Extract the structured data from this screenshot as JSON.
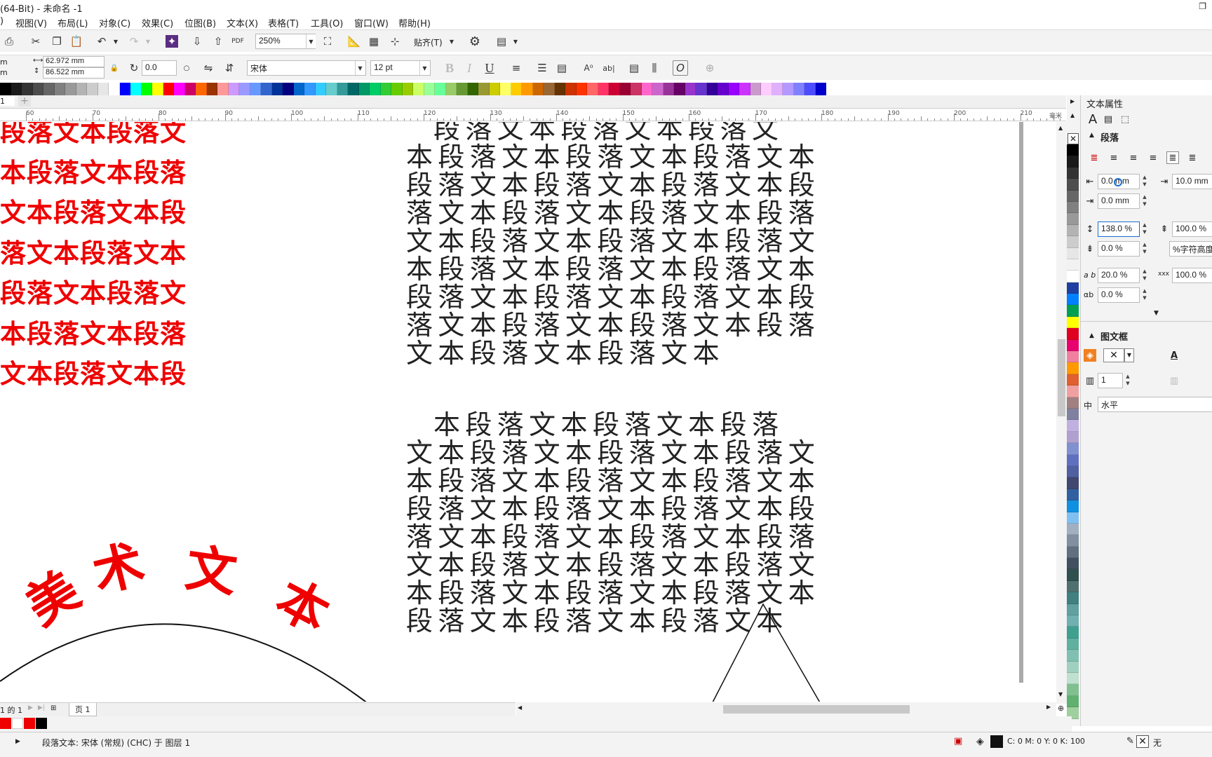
{
  "window": {
    "title": "(64-Bit) - 未命名 -1"
  },
  "menu": [
    "视图(V)",
    "布局(L)",
    "对象(C)",
    "效果(C)",
    "位图(B)",
    "文本(X)",
    "表格(T)",
    "工具(O)",
    "窗口(W)",
    "帮助(H)"
  ],
  "toolbar": {
    "zoom": "250%",
    "snap_label": "贴齐(T)"
  },
  "propbar": {
    "unit_x": "m",
    "unit_y": "m",
    "width": "62.972 mm",
    "height": "86.522 mm",
    "rotation": "0.0",
    "font": "宋体",
    "font_size": "12 pt"
  },
  "doc_tab": "1",
  "ruler": {
    "labels": [
      "60",
      "70",
      "80",
      "90",
      "100",
      "110",
      "120",
      "130",
      "140",
      "150",
      "160",
      "170",
      "180",
      "190",
      "200",
      "210"
    ],
    "unit": "毫米"
  },
  "canvas": {
    "red_lines": [
      "段落文本段落文",
      "本段落文本段落",
      "文本段落文本段",
      "落文本段落文本",
      "段落文本段落文",
      "本段落文本段落",
      "文本段落文本段"
    ],
    "block1": [
      "  段落文本段落文本段落文",
      "本段落文本段落文本段落文本",
      "段落文本段落文本段落文本段",
      "落文本段落文本段落文本段落",
      "文本段落文本段落文本段落文",
      "本段落文本段落文本段落文本",
      "段落文本段落文本段落文本段",
      "落文本段落文本段落文本段落",
      "文本段落文本段落文本"
    ],
    "block2": [
      "  本段落文本段落文本段落",
      "文本段落文本段落文本段落文",
      "本段落文本段落文本段落文本",
      "段落文本段落文本段落文本段",
      "落文本段落文本段落文本段落",
      "文本段落文本段落文本段落文",
      "本段落文本段落文本段落文本",
      "段落文本段落文本段落文本"
    ],
    "art_text": [
      "美",
      "术",
      "文",
      "本"
    ]
  },
  "docker": {
    "title": "文本属性",
    "section_paragraph": "段落",
    "left_indent": "0.0 mm",
    "first_indent": "10.0 mm",
    "right_indent": "0.0 mm",
    "line_spacing": "138.0 %",
    "before_para": "100.0 %",
    "after_para": "0.0 %",
    "spacing_unit": "%字符高度",
    "char_spacing": "20.0 %",
    "word_spacing": "100.0 %",
    "lang_spacing": "0.0 %",
    "section_frame": "图文框",
    "columns": "1",
    "direction": "水平"
  },
  "pagebar": {
    "page_of": "1 的 1",
    "page_tab": "页 1"
  },
  "status": {
    "object_info": "段落文本: 宋体 (常规) (CHC) 于 图层 1",
    "fill_info": "C: 0 M: 0 Y: 0 K: 100",
    "outline": "无"
  },
  "palette": [
    "#000000",
    "#1a1a1a",
    "#333333",
    "#4d4d4d",
    "#666666",
    "#808080",
    "#999999",
    "#b3b3b3",
    "#cccccc",
    "#e6e6e6",
    "#ffffff",
    "#0000ff",
    "#00ffff",
    "#00ff00",
    "#ffff00",
    "#ff0000",
    "#ff00ff",
    "#cc0066",
    "#ff6600",
    "#993300",
    "#ff9999",
    "#cc99ff",
    "#9999ff",
    "#6699ff",
    "#3366cc",
    "#003399",
    "#000080",
    "#0066cc",
    "#3399ff",
    "#33ccff",
    "#66cccc",
    "#339999",
    "#006666",
    "#009966",
    "#00cc66",
    "#33cc33",
    "#66cc00",
    "#99cc00",
    "#ccff66",
    "#99ff99",
    "#66ff99",
    "#99cc66",
    "#669933",
    "#336600",
    "#999933",
    "#cccc00",
    "#ffff66",
    "#ffcc00",
    "#ff9900",
    "#cc6600",
    "#996633",
    "#663300",
    "#cc3300",
    "#ff3300",
    "#ff6666",
    "#ff3366",
    "#cc0033",
    "#990033",
    "#cc3366",
    "#ff66cc",
    "#cc66cc",
    "#993399",
    "#660066",
    "#9933cc",
    "#6633cc",
    "#330099",
    "#6600cc",
    "#9900ff",
    "#cc33ff",
    "#cc99cc",
    "#ffccff",
    "#e0b0ff",
    "#b399ff",
    "#8080ff",
    "#4d4dff",
    "#0000cc"
  ],
  "vpalette": [
    "#000000",
    "#1a1a1a",
    "#333333",
    "#4d4d4d",
    "#666666",
    "#808080",
    "#999999",
    "#b3b3b3",
    "#cccccc",
    "#e6e6e6",
    "#f2f2f2",
    "#ffffff",
    "#1f3fa0",
    "#0080ff",
    "#00a050",
    "#ffff00",
    "#e00020",
    "#e8006e",
    "#f080a0",
    "#ff9900",
    "#e06030",
    "#f0a0a0",
    "#a08080",
    "#8080a0",
    "#c0b0e0",
    "#b0a0d0",
    "#8090d0",
    "#6070c0",
    "#5060a0",
    "#404870",
    "#3060a0",
    "#1090e0",
    "#80c0f0",
    "#a0b0c0",
    "#8090a0",
    "#607080",
    "#405060",
    "#305050",
    "#507070",
    "#408080",
    "#60a0a0",
    "#70b0b0",
    "#40a090",
    "#60b0a0",
    "#80c0b0",
    "#a0d0c0",
    "#c0e0d0",
    "#80c090",
    "#60b070",
    "#a0d0a0"
  ]
}
